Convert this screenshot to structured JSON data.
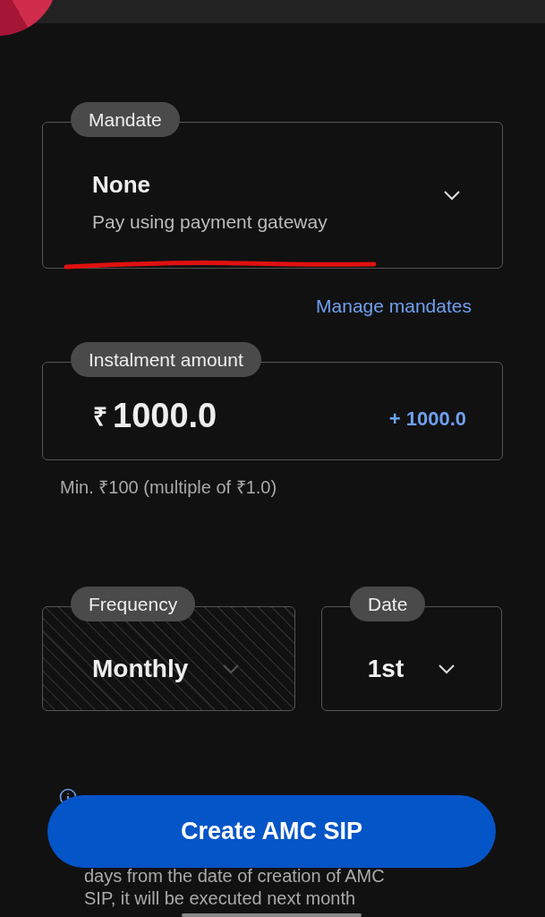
{
  "mandate": {
    "label": "Mandate",
    "value": "None",
    "hint": "Pay using payment gateway",
    "annotated": true
  },
  "manage_link": "Manage mandates",
  "instalment": {
    "label": "Instalment amount",
    "currency": "₹",
    "value": "1000.0",
    "increment": "+ 1000.0",
    "note": "Min. ₹100 (multiple of ₹1.0)"
  },
  "selects": [
    {
      "label": "Frequency",
      "value": "Monthly",
      "disabled": true
    },
    {
      "label": "Date",
      "value": "1st",
      "disabled": false
    }
  ],
  "info_lines": [
    "days from the date of creation of AMC",
    "SIP, it will be executed next month"
  ],
  "create_button": "Create AMC SIP"
}
